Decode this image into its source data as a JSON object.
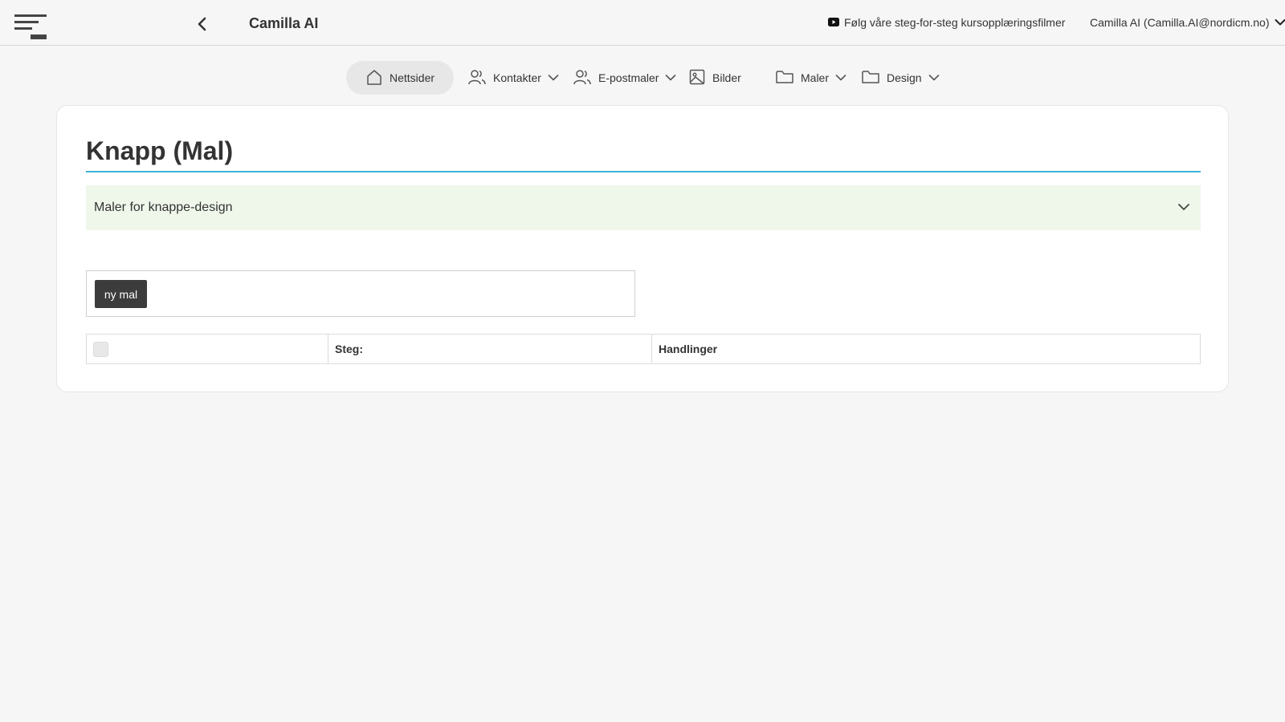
{
  "header": {
    "title": "Camilla AI",
    "tutorial_link": "Følg våre steg-for-steg kursopplæringsfilmer",
    "user": "Camilla AI (Camilla.AI@nordicm.no)"
  },
  "nav": {
    "items": [
      {
        "label": "Nettsider",
        "icon": "home-icon",
        "active": true
      },
      {
        "label": "Kontakter",
        "icon": "users-icon",
        "dropdown": true
      },
      {
        "label": "E-postmaler",
        "icon": "users-icon",
        "dropdown": true
      },
      {
        "label": "Bilder",
        "icon": "image-icon"
      },
      {
        "label": "Maler",
        "icon": "folder-icon",
        "dropdown": true
      },
      {
        "label": "Design",
        "icon": "folder-icon",
        "dropdown": true
      }
    ]
  },
  "page": {
    "title": "Knapp (Mal)",
    "accordion_label": "Maler for knappe-design",
    "new_button": "ny mal"
  },
  "table": {
    "columns": [
      "",
      "Steg:",
      "Handlinger"
    ]
  },
  "colors": {
    "accent_rule": "#3db3d8",
    "accordion_bg": "#eff7ea",
    "button_bg": "#3c3c3c"
  }
}
